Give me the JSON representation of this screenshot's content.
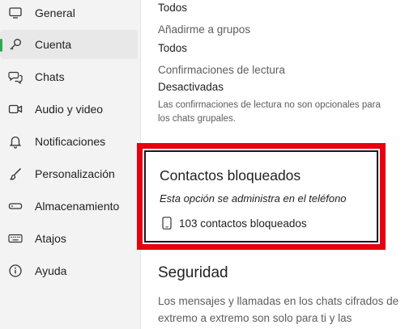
{
  "sidebar": {
    "items": [
      {
        "label": "General",
        "icon": "monitor-icon"
      },
      {
        "label": "Cuenta",
        "icon": "key-icon",
        "active": true
      },
      {
        "label": "Chats",
        "icon": "chat-bubbles-icon"
      },
      {
        "label": "Audio y video",
        "icon": "video-camera-icon"
      },
      {
        "label": "Notificaciones",
        "icon": "bell-icon"
      },
      {
        "label": "Personalización",
        "icon": "brush-icon"
      },
      {
        "label": "Almacenamiento",
        "icon": "storage-icon"
      },
      {
        "label": "Atajos",
        "icon": "keyboard-icon"
      },
      {
        "label": "Ayuda",
        "icon": "info-icon"
      }
    ],
    "active_color": "#2fa84f"
  },
  "main": {
    "top_value": "Todos",
    "groups_label": "Añadirme a grupos",
    "groups_value": "Todos",
    "read_receipts_label": "Confirmaciones de lectura",
    "read_receipts_value": "Desactivadas",
    "read_receipts_note": "Las confirmaciones de lectura no son opcionales para los chats grupales.",
    "blocked": {
      "title": "Contactos bloqueados",
      "note": "Esta opción se administra en el teléfono",
      "count_text": "103 contactos bloqueados",
      "icon": "phone-icon",
      "highlight_color": "#e60010"
    },
    "security": {
      "title": "Seguridad",
      "body": "Los mensajes y llamadas en los chats cifrados de extremo a extremo son solo para ti y las"
    }
  }
}
